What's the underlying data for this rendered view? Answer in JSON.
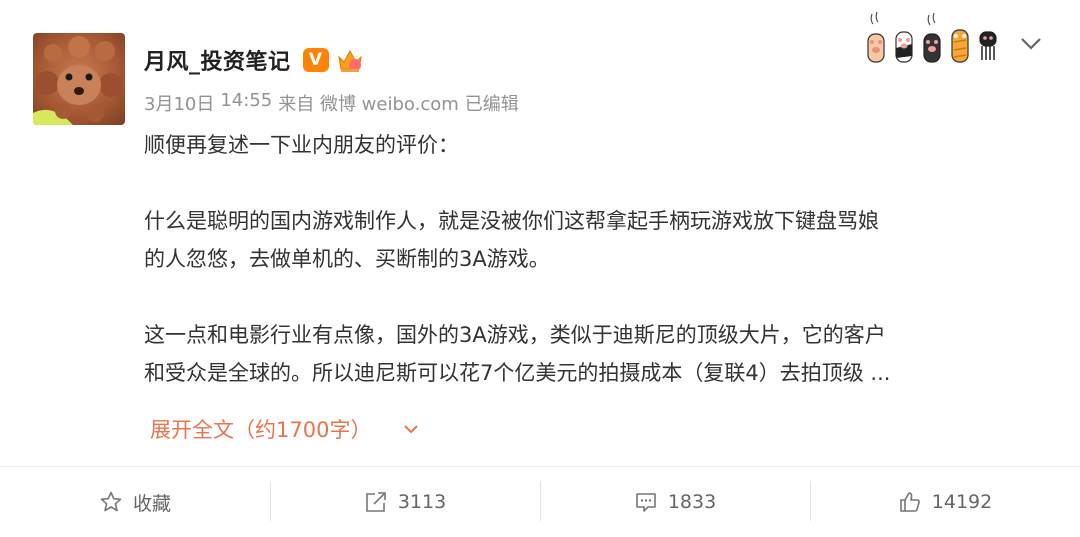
{
  "post": {
    "author": "月风_投资笔记",
    "verified_badge": "V",
    "meta": {
      "date": "3月10日",
      "time": "14:55",
      "source": "来自 微博 weibo.com",
      "edited": "已编辑"
    },
    "content": {
      "p1": "顺便再复述一下业内朋友的评价：",
      "p2_line1": "什么是聪明的国内游戏制作人，就是没被你们这帮拿起手柄玩游戏放下键盘骂娘",
      "p2_line2": "的人忽悠，去做单机的、买断制的3A游戏。",
      "p3_line1": "这一点和电影行业有点像，国外的3A游戏，类似于迪斯尼的顶级大片，它的客户",
      "p3_line2": "和受众是全球的。所以迪尼斯可以花7个亿美元的拍摄成本（复联4）去拍顶级 ..."
    },
    "expand_label": "展开全文（约1700字）"
  },
  "actions": {
    "favorite_label": "收藏",
    "repost_count": "3113",
    "comment_count": "1833",
    "like_count": "14192"
  },
  "colors": {
    "accent": "#eb7350",
    "badge": "#ff8200",
    "meta_text": "#939393",
    "body_text": "#333333"
  },
  "icons": [
    "star-icon",
    "repost-icon",
    "comment-icon",
    "thumbs-up-icon",
    "chevron-down-icon",
    "paw-icon",
    "crown-icon"
  ]
}
